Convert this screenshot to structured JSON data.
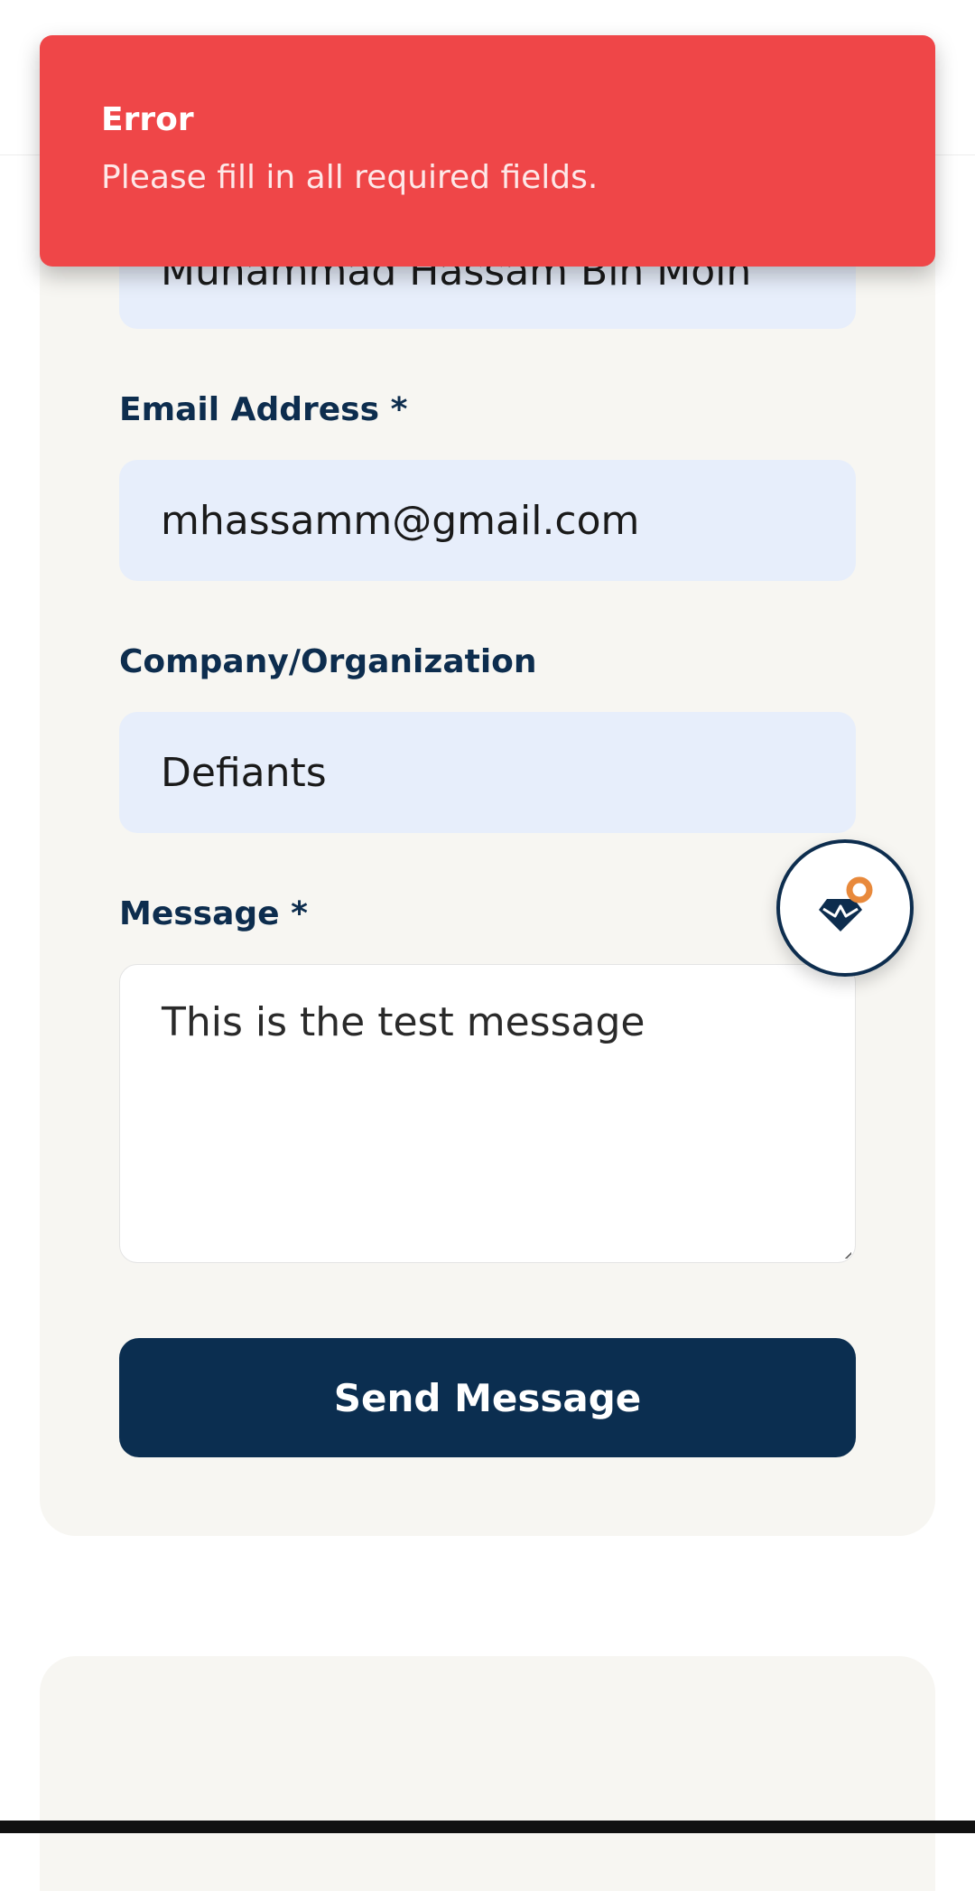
{
  "form": {
    "name_value": "Muhammad Hassam Bin Moin",
    "email_label": "Email Address *",
    "email_value": "mhassamm@gmail.com",
    "company_label": "Company/Organization",
    "company_value": "Defiants",
    "message_label": "Message *",
    "message_value": "This is the test message",
    "send_label": "Send Message"
  },
  "toast": {
    "title": "Error",
    "message": "Please fill in all required fields.",
    "color": "#ef4648"
  },
  "floating_button": {
    "icon": "diamond-location-icon",
    "accent": "#e8893b",
    "color": "#0d2d4e"
  },
  "colors": {
    "primary": "#0b2e50",
    "input_bg": "#e7eefb",
    "card_bg": "#f7f6f2"
  }
}
